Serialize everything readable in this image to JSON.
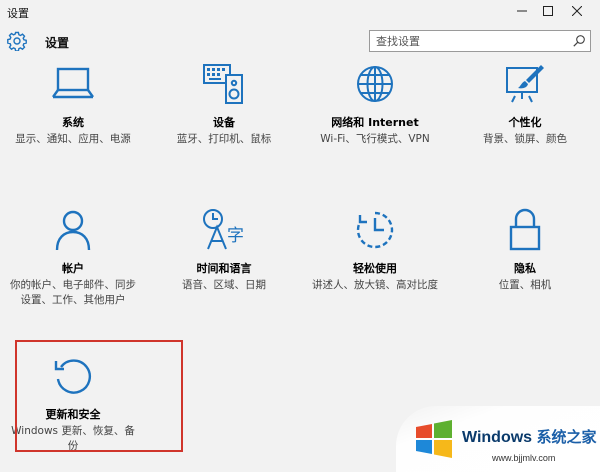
{
  "window": {
    "title": "设置",
    "controls": {
      "minimize": "minimize-icon",
      "maximize": "maximize-icon",
      "close": "close-icon"
    }
  },
  "header": {
    "icon": "gear-icon",
    "title": "设置",
    "search": {
      "placeholder": "查找设置",
      "icon": "search-icon"
    }
  },
  "tiles": [
    {
      "icon": "laptop-icon",
      "name": "系统",
      "desc": "显示、通知、应用、电源"
    },
    {
      "icon": "keyboard-speaker-icon",
      "name": "设备",
      "desc": "蓝牙、打印机、鼠标"
    },
    {
      "icon": "globe-icon",
      "name": "网络和 Internet",
      "desc": "Wi-Fi、飞行模式、VPN"
    },
    {
      "icon": "paint-icon",
      "name": "个性化",
      "desc": "背景、锁屏、颜色"
    },
    {
      "icon": "person-icon",
      "name": "帐户",
      "desc": "你的帐户、电子邮件、同步设置、工作、其他用户"
    },
    {
      "icon": "language-icon",
      "name": "时间和语言",
      "desc": "语音、区域、日期"
    },
    {
      "icon": "accessibility-icon",
      "name": "轻松使用",
      "desc": "讲述人、放大镜、高对比度"
    },
    {
      "icon": "lock-icon",
      "name": "隐私",
      "desc": "位置、相机"
    },
    {
      "icon": "sync-icon",
      "name": "更新和安全",
      "desc": "Windows 更新、恢复、备份"
    }
  ],
  "accent_color": "#1e73be",
  "highlight_color": "#d0352c",
  "watermark": {
    "title": "Windows",
    "title_cn": "系统之家",
    "url": "www.bjjmlv.com"
  }
}
